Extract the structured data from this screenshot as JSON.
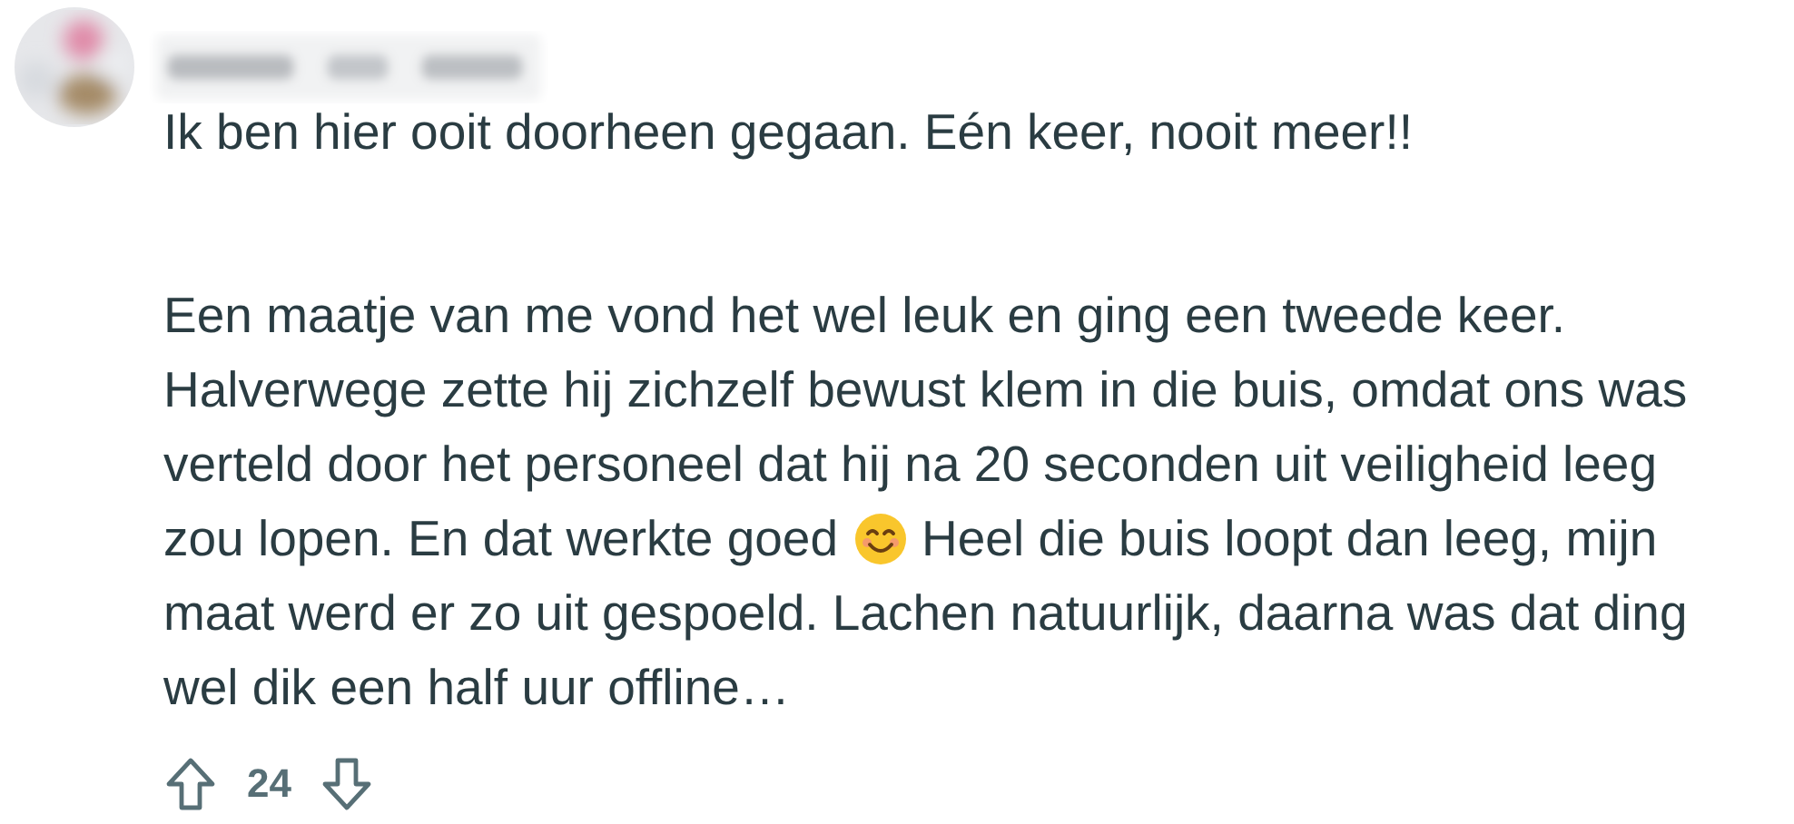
{
  "comment": {
    "paragraphs": [
      {
        "lines": [
          [
            {
              "kind": "text",
              "text": "Ik ben hier ooit doorheen gegaan. Eén keer, nooit meer!!"
            }
          ]
        ]
      },
      {
        "lines": [
          [
            {
              "kind": "text",
              "text": "Een maatje van me vond het wel leuk en ging een tweede keer."
            }
          ],
          [
            {
              "kind": "text",
              "text": "Halverwege zette hij zichzelf bewust klem in die buis, omdat ons was"
            }
          ],
          [
            {
              "kind": "text",
              "text": "verteld door het personeel dat hij na 20 seconden uit veiligheid leeg"
            }
          ],
          [
            {
              "kind": "text",
              "text": "zou lopen. En dat werkte goed"
            },
            {
              "kind": "emoji"
            },
            {
              "kind": "text",
              "text": "Heel die buis loopt dan leeg, mijn"
            }
          ],
          [
            {
              "kind": "text",
              "text": "maat werd er zo uit gespoeld. Lachen natuurlijk, daarna was dat ding"
            }
          ],
          [
            {
              "kind": "text",
              "text": "wel dik een half uur offline…"
            }
          ]
        ]
      }
    ],
    "votes": {
      "score": "24"
    }
  }
}
